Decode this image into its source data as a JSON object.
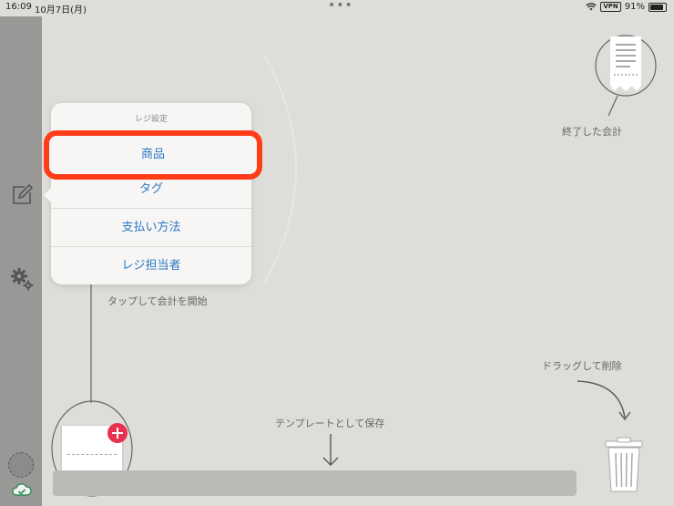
{
  "status_bar": {
    "time": "16:09",
    "date": "10月7日(月)",
    "dots": "•••",
    "vpn": "VPN",
    "battery": "91%"
  },
  "sidebar": {
    "items": [
      {
        "icon": "edit-icon"
      },
      {
        "icon": "gear-icon"
      }
    ],
    "avatar": "avatar",
    "cloud_icon": "cloud-check-icon"
  },
  "popover": {
    "title": "レジ設定",
    "items": [
      {
        "label": "商品",
        "highlighted": true
      },
      {
        "label": "タグ"
      },
      {
        "label": "支払い方法"
      },
      {
        "label": "レジ担当者"
      }
    ]
  },
  "hints": {
    "finished": "終了した会計",
    "tap_start": "タップして会計を開始",
    "drag_delete": "ドラッグして削除",
    "save_template": "テンプレートとして保存"
  },
  "colors": {
    "background": "#dfddd9",
    "sidebar": "#9a9896",
    "accent_blue": "#2a78c8",
    "highlight_red": "#ff3b18",
    "badge_red": "#e8304f"
  }
}
